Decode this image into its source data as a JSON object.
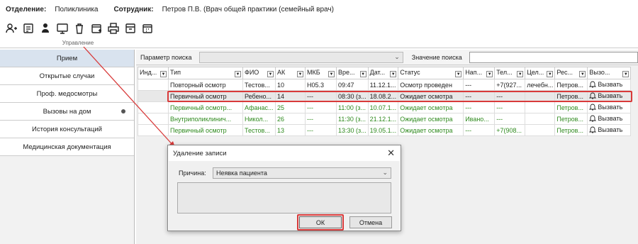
{
  "header": {
    "department_label": "Отделение:",
    "department_value": "Поликлиника",
    "employee_label": "Сотрудник:",
    "employee_value": "Петров П.В. (Врач общей практики (семейный врач)"
  },
  "toolbar": {
    "group_label": "Управление",
    "buttons": [
      "add-person-icon",
      "appointment-icon",
      "users-icon",
      "monitor-icon",
      "trash-icon",
      "calendar-add-icon",
      "print-icon",
      "archive-icon",
      "calendar-icon"
    ]
  },
  "sidebar": {
    "items": [
      {
        "label": "Прием"
      },
      {
        "label": "Открытые случаи"
      },
      {
        "label": "Проф. медосмотры"
      },
      {
        "label": "Вызовы на дом"
      },
      {
        "label": "История консультаций"
      },
      {
        "label": "Медицинская документация"
      }
    ]
  },
  "search": {
    "param_label": "Параметр поиска",
    "value_label": "Значение поиска"
  },
  "table": {
    "columns": [
      "Инд...",
      "Тип",
      "ФИО",
      "АК",
      "МКБ",
      "Вре...",
      "Дат...",
      "Статус",
      "Нап...",
      "Тел...",
      "Цел...",
      "Рес...",
      "Вызо..."
    ],
    "call_label": "Вызвать",
    "rows": [
      [
        "",
        "Повторный осмотр",
        "Тестов...",
        "10",
        "H05.3",
        "09:47",
        "11.12.1...",
        "Осмотр проведен",
        "---",
        "+7(927...",
        "лечебн...",
        "Петров..."
      ],
      [
        "",
        "Первичный осмотр",
        "Ребено...",
        "14",
        "---",
        "08:30 (з...",
        "18.08.2...",
        "Ожидает осмотра",
        "---",
        "---",
        "",
        "Петров..."
      ],
      [
        "",
        "Первичный осмотр...",
        "Афанас...",
        "25",
        "---",
        "11:00 (з...",
        "10.07.1...",
        "Ожидает осмотра",
        "---",
        "---",
        "",
        "Петров..."
      ],
      [
        "",
        "Внутриполиклинич...",
        "Никол...",
        "26",
        "---",
        "11:30 (з...",
        "21.12.1...",
        "Ожидает осмотра",
        "Ивано...",
        "---",
        "",
        "Петров..."
      ],
      [
        "",
        "Первичный осмотр",
        "Тестов...",
        "13",
        "---",
        "13:30 (з...",
        "19.05.1...",
        "Ожидает осмотра",
        "---",
        "+7(908...",
        "",
        "Петров..."
      ]
    ]
  },
  "dialog": {
    "title": "Удаление записи",
    "reason_label": "Причина:",
    "reason_value": "Неявка пациента",
    "ok_label": "ОК",
    "cancel_label": "Отмена"
  },
  "colors": {
    "highlight": "#d83a3a",
    "green_text": "#2f8a1e",
    "active_sidebar": "#d9e3ef"
  }
}
